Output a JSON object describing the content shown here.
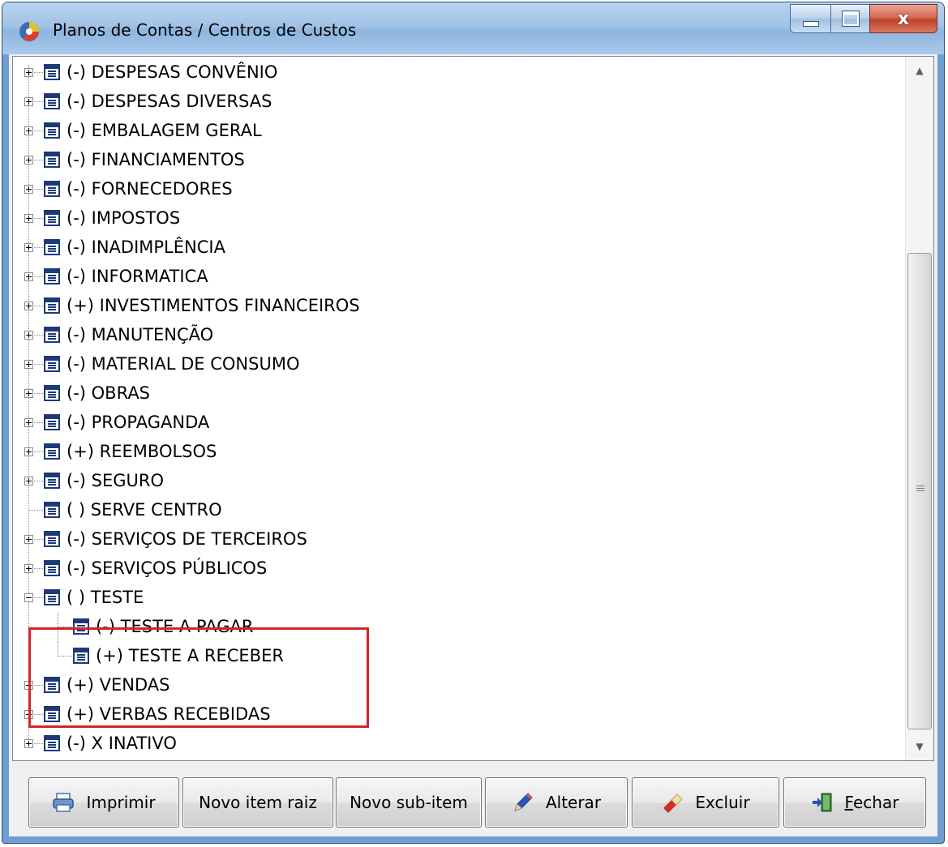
{
  "window": {
    "title": "Planos de Contas / Centros de Custos",
    "close_glyph": "x",
    "accent_color": "#d4252b"
  },
  "tree": {
    "items": [
      {
        "label": "(-) DESPESAS CONVÊNIO",
        "level": 0,
        "expander": "plus"
      },
      {
        "label": "(-) DESPESAS DIVERSAS",
        "level": 0,
        "expander": "plus"
      },
      {
        "label": "(-) EMBALAGEM GERAL",
        "level": 0,
        "expander": "plus"
      },
      {
        "label": "(-) FINANCIAMENTOS",
        "level": 0,
        "expander": "plus"
      },
      {
        "label": "(-) FORNECEDORES",
        "level": 0,
        "expander": "plus"
      },
      {
        "label": "(-) IMPOSTOS",
        "level": 0,
        "expander": "plus"
      },
      {
        "label": "(-) INADIMPLÊNCIA",
        "level": 0,
        "expander": "plus"
      },
      {
        "label": "(-) INFORMATICA",
        "level": 0,
        "expander": "plus"
      },
      {
        "label": "(+) INVESTIMENTOS FINANCEIROS",
        "level": 0,
        "expander": "plus"
      },
      {
        "label": "(-) MANUTENÇÃO",
        "level": 0,
        "expander": "plus"
      },
      {
        "label": "(-) MATERIAL DE CONSUMO",
        "level": 0,
        "expander": "plus"
      },
      {
        "label": "(-) OBRAS",
        "level": 0,
        "expander": "plus"
      },
      {
        "label": "(-) PROPAGANDA",
        "level": 0,
        "expander": "plus"
      },
      {
        "label": "(+) REEMBOLSOS",
        "level": 0,
        "expander": "plus"
      },
      {
        "label": "(-) SEGURO",
        "level": 0,
        "expander": "plus"
      },
      {
        "label": "( ) SERVE CENTRO",
        "level": 0,
        "expander": "none"
      },
      {
        "label": "(-) SERVIÇOS DE TERCEIROS",
        "level": 0,
        "expander": "plus"
      },
      {
        "label": "(-) SERVIÇOS PÚBLICOS",
        "level": 0,
        "expander": "plus"
      },
      {
        "label": "( ) TESTE",
        "level": 0,
        "expander": "minus"
      },
      {
        "label": "(-) TESTE A PAGAR",
        "level": 1,
        "expander": "none"
      },
      {
        "label": "(+) TESTE A RECEBER",
        "level": 1,
        "expander": "none"
      },
      {
        "label": "(+) VENDAS",
        "level": 0,
        "expander": "plus"
      },
      {
        "label": "(+) VERBAS RECEBIDAS",
        "level": 0,
        "expander": "plus"
      },
      {
        "label": "(-) X INATIVO",
        "level": 0,
        "expander": "plus"
      }
    ]
  },
  "buttons": {
    "imprimir": {
      "label": "Imprimir",
      "icon": "printer-icon"
    },
    "novo_item_raiz": {
      "label": "Novo item raiz"
    },
    "novo_sub_item": {
      "label": "Novo sub-item"
    },
    "alterar": {
      "label": "Alterar",
      "icon": "pencil-icon"
    },
    "excluir": {
      "label": "Excluir",
      "icon": "eraser-icon"
    },
    "fechar": {
      "label": "Fechar",
      "icon": "exit-door-icon",
      "accelerator": "F",
      "rest": "echar"
    }
  }
}
